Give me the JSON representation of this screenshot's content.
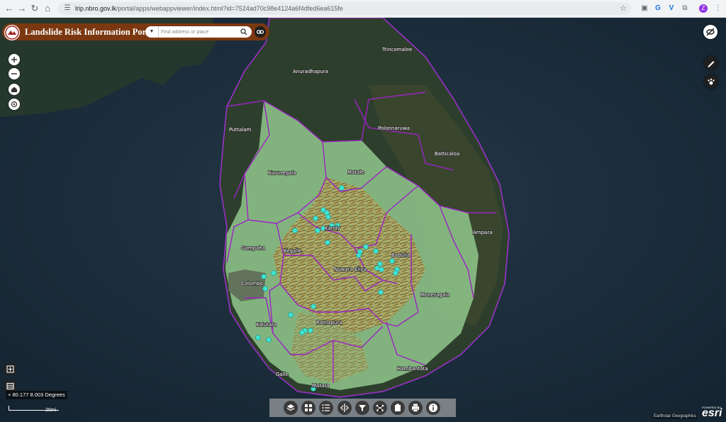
{
  "browser": {
    "url_host": "lrip.nbro.gov.lk",
    "url_path": "/portal/apps/webappviewer/index.html?id=7524ad70c98e4124a6f4dfed6ea615fe"
  },
  "app": {
    "title": "Landslide Risk Information Portal",
    "search_placeholder": "Find address or place"
  },
  "districts": [
    {
      "name": "Trincomalee"
    },
    {
      "name": "Anuradhapura"
    },
    {
      "name": "Puttalam"
    },
    {
      "name": "Polonnaruwa"
    },
    {
      "name": "Batticaloa"
    },
    {
      "name": "Kurunegala"
    },
    {
      "name": "Matale"
    },
    {
      "name": "Kandy"
    },
    {
      "name": "Ampara"
    },
    {
      "name": "Gampaha"
    },
    {
      "name": "Kegalle"
    },
    {
      "name": "Badulla"
    },
    {
      "name": "Nuwara Eliya"
    },
    {
      "name": "Colombo"
    },
    {
      "name": "Moneragala"
    },
    {
      "name": "Kalutara"
    },
    {
      "name": "Ratnapura"
    },
    {
      "name": "Hambantota"
    },
    {
      "name": "Galle"
    },
    {
      "name": "Matara"
    }
  ],
  "status": {
    "coordinates": "80.177 8.003 Degrees",
    "scale": "20mi",
    "attribution": "Earthstar Geographics",
    "powered_by": "POWERED BY",
    "esri": "esri"
  },
  "colors": {
    "header": "#7b3810",
    "point": "#3fe3d2",
    "boundary": "#9c22c4",
    "risk_zone": "#8ec48a"
  }
}
